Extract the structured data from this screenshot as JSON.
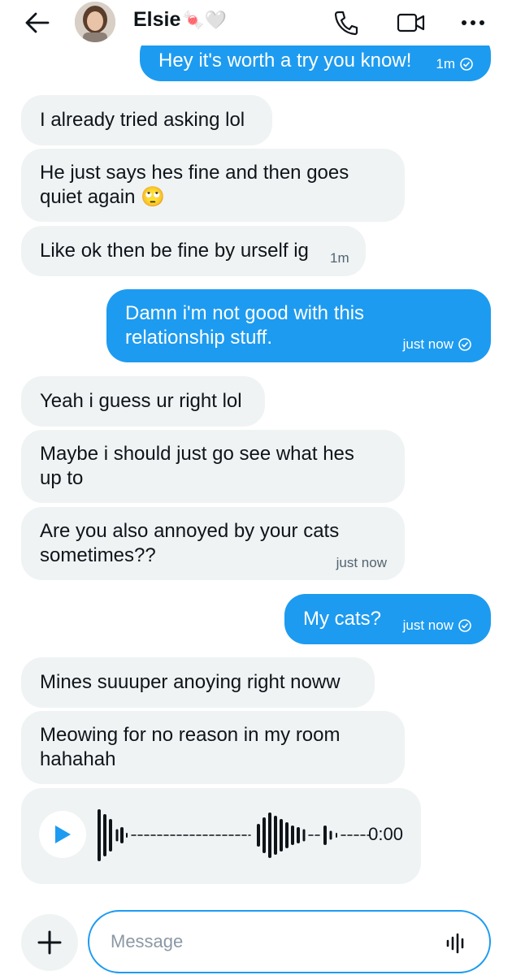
{
  "header": {
    "contact_name": "Elsie",
    "name_emoji": "🍬🤍"
  },
  "messages": [
    {
      "dir": "out",
      "text": "Hey it's worth a try you know!",
      "time": "1m"
    },
    {
      "dir": "in",
      "text": "I already tried asking lol"
    },
    {
      "dir": "in",
      "text": "He just says hes fine and then goes quiet again 🙄"
    },
    {
      "dir": "in",
      "text": "Like ok then be fine by urself ig",
      "time": "1m"
    },
    {
      "dir": "out",
      "text": "Damn i'm not good with this relationship stuff.",
      "time": "just now"
    },
    {
      "dir": "in",
      "text": "Yeah i guess ur right lol"
    },
    {
      "dir": "in",
      "text": "Maybe i should just go see what hes up to"
    },
    {
      "dir": "in",
      "text": "Are you also annoyed by your cats sometimes??",
      "time": "just now"
    },
    {
      "dir": "out",
      "text": "My cats?",
      "time": "just now"
    },
    {
      "dir": "in",
      "text": "Mines suuuper anoying right noww"
    },
    {
      "dir": "in",
      "text": "Meowing for no reason in my room hahahah"
    }
  ],
  "voice_note": {
    "duration": "0:00"
  },
  "composer": {
    "placeholder": "Message"
  },
  "colors": {
    "accent": "#1d9bf0",
    "incoming_bg": "#eff3f4",
    "meta": "#536471"
  }
}
